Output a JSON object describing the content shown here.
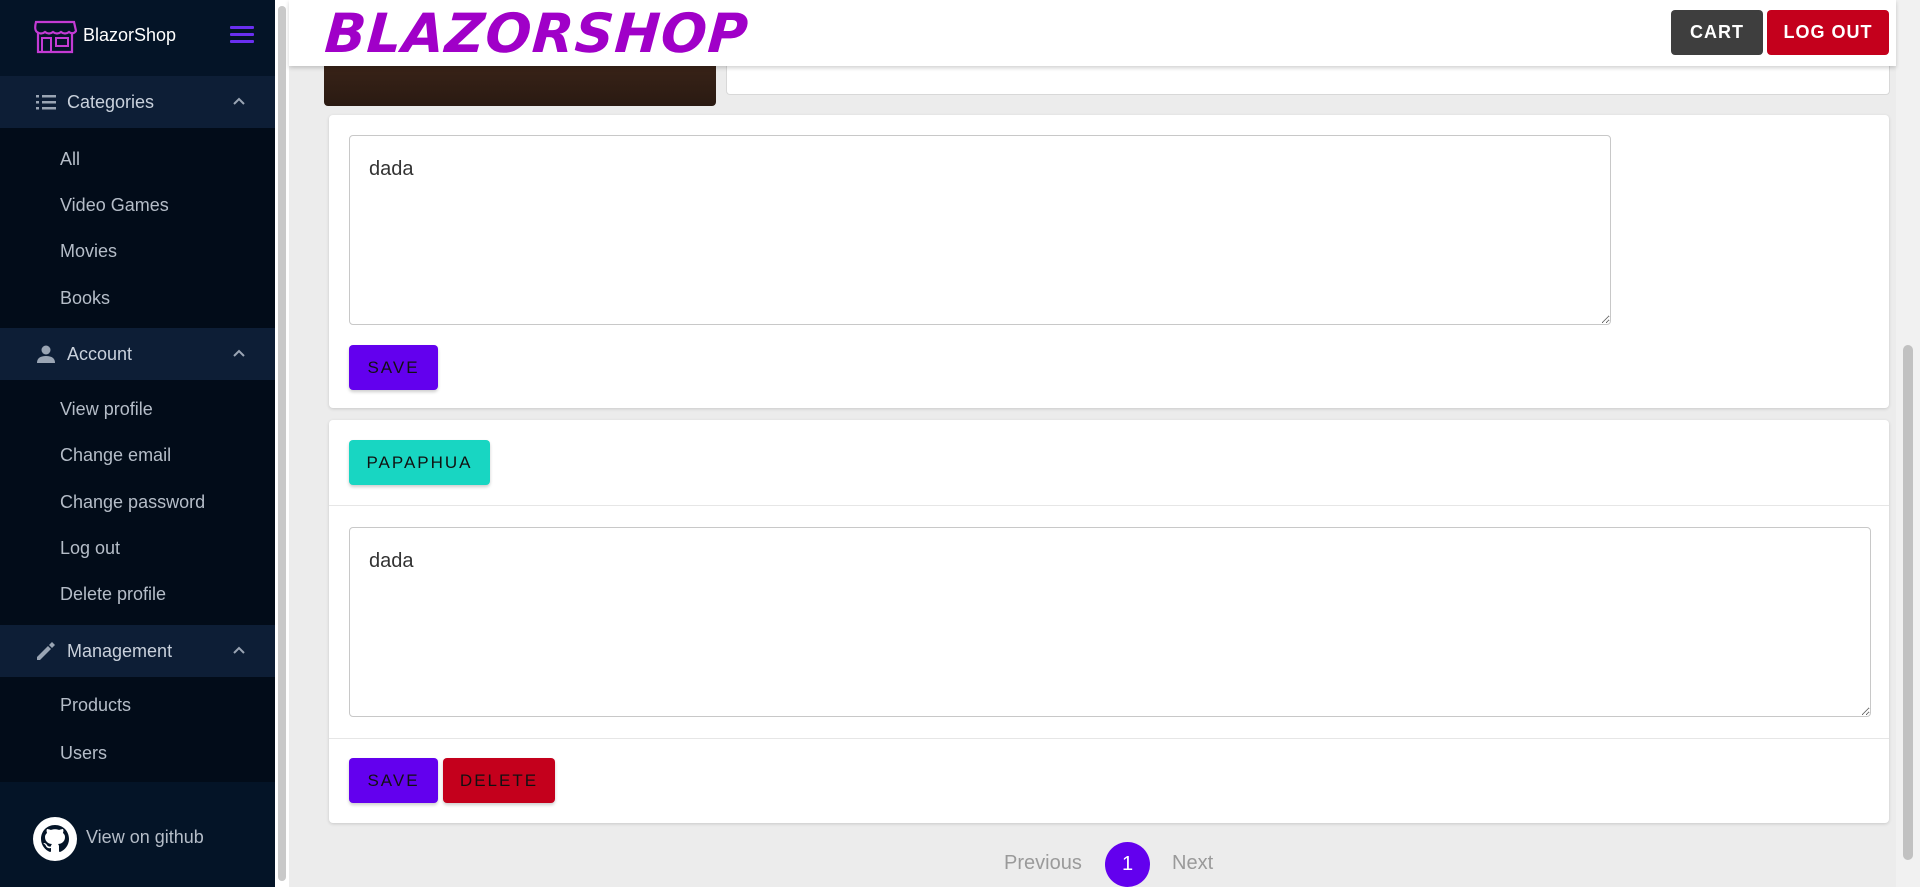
{
  "sidebar": {
    "brand": "BlazorShop",
    "groups": [
      {
        "label": "Categories",
        "items": [
          "All",
          "Video Games",
          "Movies",
          "Books"
        ]
      },
      {
        "label": "Account",
        "items": [
          "View profile",
          "Change email",
          "Change password",
          "Log out",
          "Delete profile"
        ]
      },
      {
        "label": "Management",
        "items": [
          "Products",
          "Users"
        ]
      }
    ],
    "github_label": "View on github"
  },
  "header": {
    "title": "BLAZORSHOP",
    "cart_label": "CART",
    "logout_label": "LOG OUT"
  },
  "reviews": [
    {
      "text": "dada",
      "save_label": "SAVE"
    },
    {
      "user": "PAPAPHUA",
      "text": "dada",
      "save_label": "SAVE",
      "delete_label": "DELETE"
    }
  ],
  "pagination": {
    "previous": "Previous",
    "current": "1",
    "next": "Next"
  },
  "colors": {
    "sidebar_bg": "#041427",
    "brand_purple": "#a000c8",
    "primary": "#6300ee",
    "danger": "#c4001c",
    "secondary": "#18d6c2",
    "dark": "#3e3e3e"
  }
}
